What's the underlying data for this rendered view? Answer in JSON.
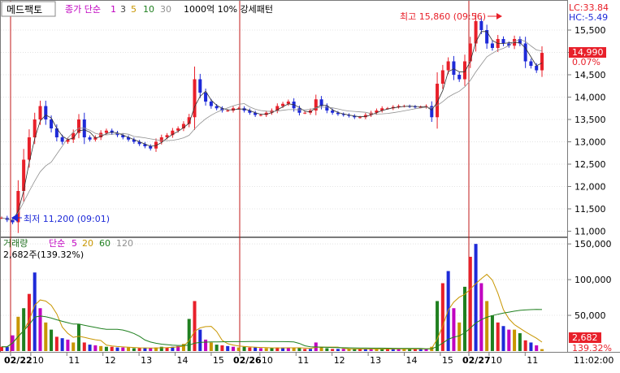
{
  "header": {
    "stock_name": "메드팩토",
    "ma_type_label": "종가 단순",
    "ma_periods": [
      {
        "label": "1",
        "color": "#c000c0"
      },
      {
        "label": "3",
        "color": "#404040"
      },
      {
        "label": "5",
        "color": "#c89600"
      },
      {
        "label": "10",
        "color": "#208020"
      },
      {
        "label": "30",
        "color": "#909090"
      }
    ],
    "pattern_label": "1000억 10% 강세패턴"
  },
  "info": {
    "lc": "LC:33.84",
    "hc": "HC:-5.49",
    "current_price": "14,990",
    "current_change": "0.07%",
    "current_volume": "2,682",
    "volume_change": "139.32%"
  },
  "annotations": {
    "high": "최고 15,860 (09:56)",
    "low": "최저 11,200 (09:01)"
  },
  "volume_header": {
    "title": "거래량",
    "ma_type_label": "단순",
    "ma_periods": [
      {
        "label": "5",
        "color": "#c000c0"
      },
      {
        "label": "20",
        "color": "#c89600"
      },
      {
        "label": "60",
        "color": "#208020"
      },
      {
        "label": "120",
        "color": "#909090"
      }
    ],
    "current": "2,682주(139.32%)"
  },
  "colors": {
    "up": "#e8202a",
    "down": "#1e2ad8",
    "ma_short": "#303030",
    "ma_long": "#909090",
    "day_separator": "#c01818",
    "info_blue": "#1e2ad8",
    "info_red": "#e8202a",
    "price_box": "#e8202a"
  },
  "chart_data": [
    {
      "type": "line",
      "title": "",
      "ylim": [
        10900,
        16100
      ],
      "y_ticks": [
        "15,500",
        "15,000",
        "14,500",
        "14,000",
        "13,500",
        "13,000",
        "12,500",
        "12,000",
        "11,500",
        "11,000"
      ],
      "y_tick_values": [
        15500,
        15000,
        14500,
        14000,
        13500,
        13000,
        12500,
        12000,
        11500,
        11000
      ],
      "x_ticks": [
        {
          "label": "02/22",
          "day_start": true
        },
        {
          "label": "10",
          "day_start": false
        },
        {
          "label": "11",
          "day_start": false
        },
        {
          "label": "12",
          "day_start": false
        },
        {
          "label": "13",
          "day_start": false
        },
        {
          "label": "14",
          "day_start": false
        },
        {
          "label": "15",
          "day_start": false
        },
        {
          "label": "02/26",
          "day_start": true
        },
        {
          "label": "10",
          "day_start": false
        },
        {
          "label": "11",
          "day_start": false
        },
        {
          "label": "12",
          "day_start": false
        },
        {
          "label": "13",
          "day_start": false
        },
        {
          "label": "14",
          "day_start": false
        },
        {
          "label": "15",
          "day_start": false
        },
        {
          "label": "02/27",
          "day_start": true
        },
        {
          "label": "10",
          "day_start": false
        },
        {
          "label": "11",
          "day_start": false
        }
      ],
      "time_axis_label": "11:02:00",
      "series": [
        {
          "values": [
            11300,
            11250,
            11200,
            11900,
            12600,
            13100,
            13500,
            13800,
            13500,
            13300,
            13100,
            13000,
            13050,
            13200,
            13500,
            13100,
            13050,
            13100,
            13200,
            13250,
            13200,
            13150,
            13100,
            13050,
            13000,
            12950,
            12900,
            12850,
            13000,
            13100,
            13150,
            13250,
            13300,
            13400,
            13550,
            14400,
            14100,
            13900,
            13800,
            13750,
            13700,
            13700,
            13750,
            13750,
            13700,
            13650,
            13600,
            13600,
            13650,
            13700,
            13800,
            13850,
            13900,
            13750,
            13650,
            13650,
            13700,
            13950,
            13800,
            13700,
            13650,
            13620,
            13600,
            13580,
            13550,
            13550,
            13600,
            13650,
            13700,
            13750,
            13750,
            13780,
            13800,
            13800,
            13790,
            13780,
            13780,
            13800,
            13550,
            14300,
            14600,
            14800,
            14500,
            14400,
            14800,
            15200,
            15700,
            15500,
            15200,
            15100,
            15300,
            15200,
            15150,
            15300,
            15200,
            14800,
            14700,
            14600,
            14990
          ]
        }
      ],
      "high": 15860,
      "low": 11200,
      "grid": true
    },
    {
      "type": "bar",
      "title": "",
      "ylim": [
        0,
        157000
      ],
      "y_ticks": [
        "150,000",
        "100,000",
        "50,000"
      ],
      "y_tick_values": [
        150000,
        100000,
        50000
      ],
      "series": [
        {
          "name": "거래량",
          "values": [
            6000,
            6000,
            22000,
            48000,
            60000,
            80000,
            110000,
            60000,
            40000,
            30000,
            20000,
            18000,
            16000,
            12000,
            38000,
            12000,
            9000,
            8000,
            7000,
            6000,
            6000,
            5000,
            5000,
            5000,
            4000,
            4000,
            4000,
            4000,
            5000,
            6000,
            5000,
            6000,
            7000,
            10000,
            45000,
            70000,
            30000,
            16000,
            12000,
            9000,
            8000,
            7000,
            6000,
            5000,
            6000,
            5000,
            5000,
            4000,
            4000,
            4000,
            5000,
            5000,
            5000,
            4000,
            4000,
            3000,
            3000,
            12000,
            6000,
            4000,
            3000,
            3000,
            3000,
            3000,
            3000,
            3000,
            3000,
            3000,
            3000,
            3000,
            3000,
            3000,
            3000,
            3000,
            3000,
            3000,
            3000,
            3000,
            6000,
            70000,
            95000,
            112000,
            60000,
            40000,
            90000,
            132000,
            150000,
            95000,
            70000,
            50000,
            40000,
            35000,
            30000,
            30000,
            25000,
            15000,
            12000,
            8000,
            2682
          ]
        }
      ]
    }
  ]
}
